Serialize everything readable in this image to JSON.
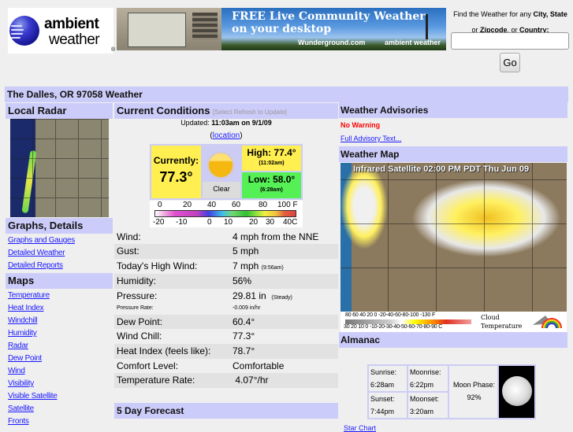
{
  "header": {
    "logo": {
      "line1": "ambient",
      "line2": "weather",
      "reg": "®"
    },
    "banner": {
      "line1": "FREE Live Community Weather",
      "line2": "on your desktop",
      "partner1": "Wunderground.com",
      "partner2": "ambient weather"
    },
    "search": {
      "label_part1": "Find the Weather for any ",
      "label_bold1": "City, State",
      "label_part2": "or ",
      "label_bold2": "Zipcode",
      "label_part3": ", or ",
      "label_bold3": "Country:",
      "value": "",
      "placeholder": "",
      "go_label": "Go"
    }
  },
  "page_title": "The Dalles, OR 97058 Weather",
  "left": {
    "radar_header": "Local Radar",
    "graphs_header": "Graphs, Details",
    "graphs_links": [
      "Graphs and Gauges",
      "Detailed Weather",
      "Detailed Reports"
    ],
    "maps_header": "Maps",
    "maps_links": [
      "Temperature",
      "Heat Index",
      "Windchill",
      "Humidity",
      "Radar",
      "Dew Point",
      "Wind",
      "Visibility",
      "Visible Satellite",
      "Satellite",
      "Fronts"
    ]
  },
  "current": {
    "header": "Current Conditions",
    "header_sub": "[Select Refresh to Update]",
    "updated_label": "Updated:",
    "updated_value": "11:03am on 9/1/09",
    "location_link": "location",
    "currently_label": "Currently:",
    "currently_value": "77.3°",
    "sky_icon": "sun-icon",
    "sky_condition": "Clear",
    "high": "High: 77.4°",
    "high_time": "(11:02am)",
    "low": "Low: 58.0°",
    "low_time": "(6:28am)",
    "scale_f": [
      "0",
      "20",
      "40",
      "60",
      "80",
      "100 F"
    ],
    "scale_c": [
      "-20",
      "-10",
      "0",
      "10",
      "20",
      "30",
      "40C"
    ],
    "rows": [
      {
        "label": "Wind:",
        "value": "4 mph from the NNE",
        "note": ""
      },
      {
        "label": "Gust:",
        "value": "5 mph",
        "note": ""
      },
      {
        "label": "Today's High Wind:",
        "value": "7 mph",
        "note": "(9:56am)"
      },
      {
        "label": "Humidity:",
        "value": "56%",
        "note": ""
      },
      {
        "label": "Pressure:",
        "value": "29.81 in",
        "note": "(Steady)"
      },
      {
        "label": "Pressure Rate:",
        "value": "-0.009 in/hr",
        "note": ""
      },
      {
        "label": "Dew Point:",
        "value": "60.4°",
        "note": ""
      },
      {
        "label": "Wind Chill:",
        "value": "77.3°",
        "note": ""
      },
      {
        "label": "Heat Index (feels like):",
        "value": "78.7°",
        "note": ""
      },
      {
        "label": "Comfort Level:",
        "value": "Comfortable",
        "note": ""
      },
      {
        "label": "Temperature Rate:",
        "value": " 4.07°/hr",
        "note": ""
      }
    ],
    "forecast_header": "5 Day Forecast"
  },
  "right": {
    "advisories_header": "Weather Advisories",
    "warning": "No Warning",
    "advisory_link": "Full Advisory Text...",
    "map_header": "Weather Map",
    "map_title": "Infrared Satellite 02:00 PM PDT Thu Jun 09",
    "legend_f": "80 60 40 20  0 -20-40-60-80-100 -130 F",
    "legend_c": "30 20 10  0 -10-20-30-40-50-60-70-80-90  C",
    "legend_caption1": "Cloud",
    "legend_caption2": "Temperature",
    "almanac_header": "Almanac",
    "sunrise_label": "Sunrise:",
    "sunrise": "6:28am",
    "sunset_label": "Sunset:",
    "sunset": "7:44pm",
    "moonrise_label": "Moonrise:",
    "moonrise": "6:22pm",
    "moonset_label": "Moonset:",
    "moonset": "3:20am",
    "moon_phase_label": "Moon Phase:",
    "moon_phase": "92%",
    "star_chart_link": "Star Chart"
  }
}
